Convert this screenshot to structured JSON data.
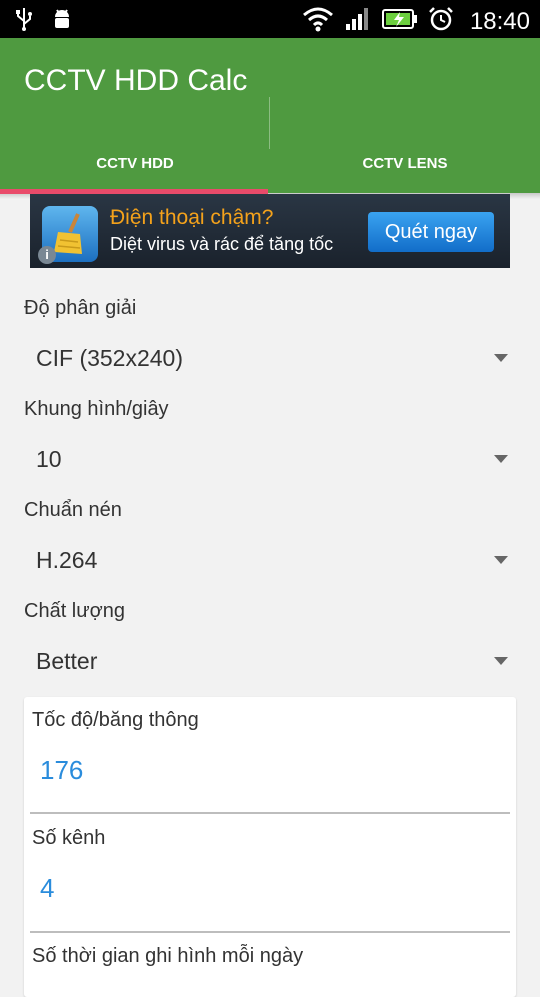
{
  "status_bar": {
    "time": "18:40",
    "icons": [
      "usb-icon",
      "android-debug-icon",
      "wifi-icon",
      "signal-icon",
      "battery-charging-icon",
      "alarm-icon"
    ]
  },
  "app": {
    "title": "CCTV HDD Calc",
    "accent_color": "#4f9a40",
    "indicator_color": "#e94b6a"
  },
  "tabs": [
    {
      "label": "CCTV HDD",
      "selected": true
    },
    {
      "label": "CCTV LENS",
      "selected": false
    }
  ],
  "ad": {
    "title": "Điện thoại chậm?",
    "subtitle": "Diệt virus và rác để tăng tốc",
    "button_label": "Quét ngay",
    "info_glyph": "i"
  },
  "fields": {
    "resolution": {
      "label": "Độ phân giải",
      "value": "CIF (352x240)"
    },
    "fps": {
      "label": "Khung hình/giây",
      "value": "10"
    },
    "codec": {
      "label": "Chuẩn nén",
      "value": "H.264"
    },
    "quality": {
      "label": "Chất lượng",
      "value": "Better"
    }
  },
  "card": {
    "bandwidth": {
      "label": "Tốc độ/băng thông",
      "value": "176"
    },
    "channels": {
      "label": "Số kênh",
      "value": "4"
    },
    "hours": {
      "label": "Số thời gian ghi hình mỗi ngày"
    }
  }
}
